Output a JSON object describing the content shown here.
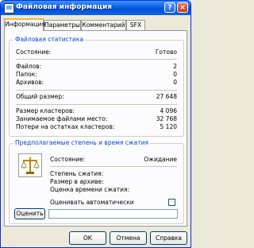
{
  "window": {
    "title": "Файловая информация",
    "help_glyph": "?",
    "close_glyph": "×",
    "icons": [
      "app-icon",
      "help-icon",
      "close-icon"
    ]
  },
  "tabs": [
    "Информация",
    "Параметры",
    "Комментарий",
    "SFX"
  ],
  "stats": {
    "group_title": "Файловая статистика",
    "state_label": "Состояние:",
    "state_value": "Готово",
    "files_label": "Файлов:",
    "files_value": "2",
    "folders_label": "Папок:",
    "folders_value": "0",
    "archives_label": "Архивов:",
    "archives_value": "0",
    "total_size_label": "Общий размер:",
    "total_size_value": "27 648",
    "cluster_size_label": "Размер кластеров:",
    "cluster_size_value": "4 096",
    "occupied_label": "Занимаемое файлами место:",
    "occupied_value": "32 768",
    "losses_label": "Потери на остатках кластеров:",
    "losses_value": "5 120"
  },
  "compression": {
    "group_title": "Предполагаемые степень и время сжатия",
    "icon": "scales-icon",
    "state_label": "Состояние:",
    "state_value": "Ожидание",
    "ratio_label": "Степень сжатия:",
    "archive_size_label": "Размер в архиве:",
    "time_label": "Оценка времени сжатия:",
    "auto_label": "Оценивать автоматически",
    "auto_checked": false,
    "estimate_button": "Оценить"
  },
  "buttons": {
    "ok": "ОК",
    "cancel": "Отмена",
    "help": "Справка"
  }
}
